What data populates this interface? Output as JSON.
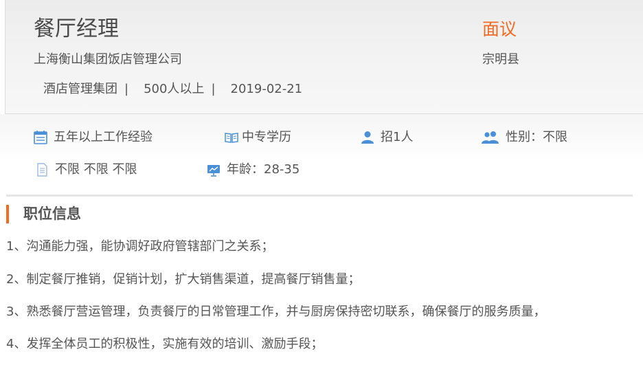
{
  "job": {
    "title": "餐厅经理",
    "company": "上海衡山集团饭店管理公司",
    "industry": "酒店管理集团",
    "size": "500人以上",
    "date": "2019-02-21",
    "separator": "|",
    "salary": "面议",
    "location": "宗明县"
  },
  "colors": {
    "accent": "#f26b21",
    "icon_blue": "#4a90d9"
  },
  "attributes": {
    "experience": {
      "icon": "calendar-icon",
      "text": "五年以上工作经验"
    },
    "education": {
      "icon": "book-icon",
      "text": "中专学历"
    },
    "headcount": {
      "icon": "person-icon",
      "text": "招1人"
    },
    "gender": {
      "icon": "people-icon",
      "text": "性别：不限"
    },
    "requirements": {
      "icon": "document-icon",
      "text": "不限 不限 不限"
    },
    "age": {
      "icon": "presentation-icon",
      "text": "年龄：28-35"
    }
  },
  "section": {
    "title": "职位信息",
    "lines": [
      "1、沟通能力强，能协调好政府管辖部门之关系；",
      "2、制定餐厅推销，促销计划，扩大销售渠道，提高餐厅销售量；",
      "3、熟悉餐厅营运管理，负责餐厅的日常管理工作，并与厨房保持密切联系，确保餐厅的服务质量，",
      "4、发挥全体员工的积极性，实施有效的培训、激励手段；"
    ]
  }
}
